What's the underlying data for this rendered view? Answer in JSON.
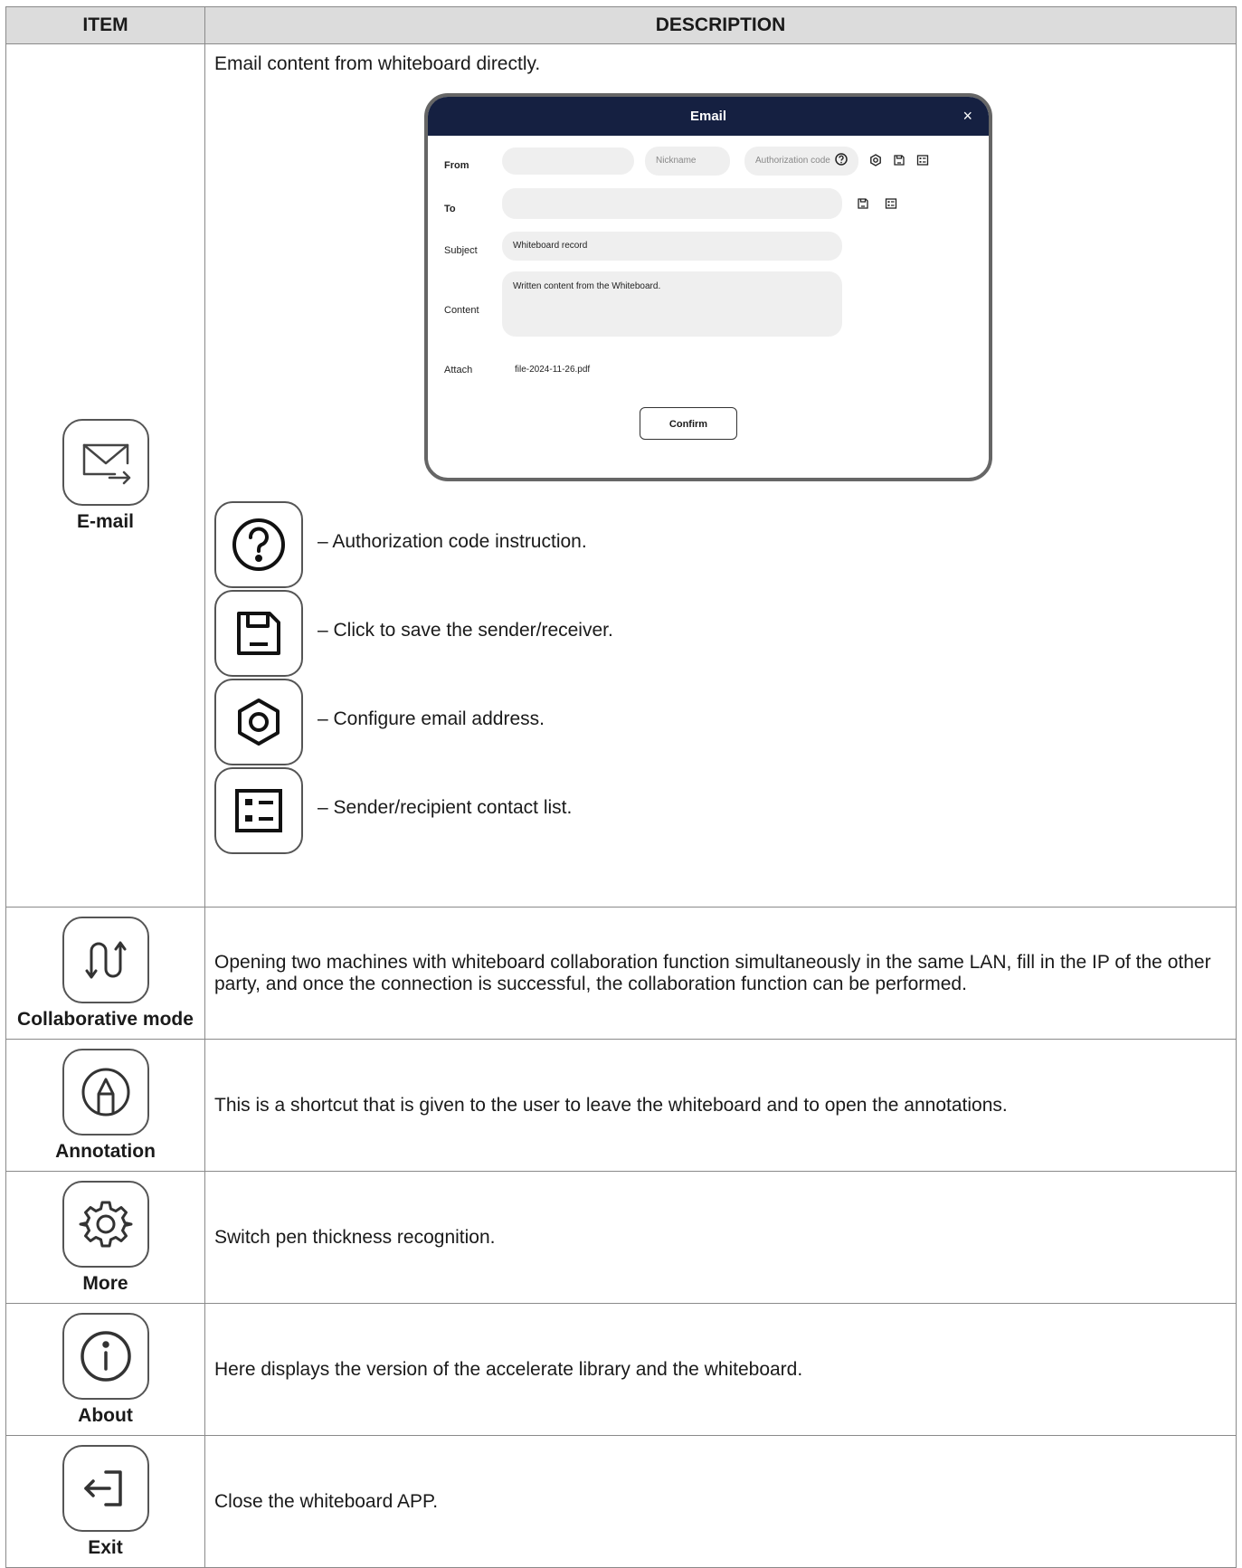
{
  "header": {
    "item": "ITEM",
    "description": "DESCRIPTION"
  },
  "email": {
    "label": "E-mail",
    "intro": "Email content from whiteboard directly.",
    "dialog": {
      "title": "Email",
      "close": "×",
      "from_label": "From",
      "nickname_placeholder": "Nickname",
      "auth_placeholder": "Authorization code",
      "to_label": "To",
      "subject_label": "Subject",
      "subject_value": "Whiteboard record",
      "content_label": "Content",
      "content_value": "Written content from the Whiteboard.",
      "attach_label": "Attach",
      "attach_value": "file-2024-11-26.pdf",
      "confirm": "Confirm"
    },
    "legend": [
      {
        "icon": "question-circle-icon",
        "text": "– Authorization code instruction."
      },
      {
        "icon": "save-icon",
        "text": "– Click to save the sender/receiver."
      },
      {
        "icon": "settings-hex-icon",
        "text": "– Configure email address."
      },
      {
        "icon": "contact-list-icon",
        "text": "– Sender/recipient contact list."
      }
    ]
  },
  "rows": [
    {
      "icon": "collaboration-arrows-icon",
      "label": "Collaborative mode",
      "description": "Opening two machines with whiteboard collaboration function simultaneously in the same LAN, fill in the IP of the other party, and once the connection is successful, the collaboration function can be performed."
    },
    {
      "icon": "annotation-pen-icon",
      "label": "Annotation",
      "description": "This is a shortcut that is given to the user to leave the whiteboard and to open the annotations."
    },
    {
      "icon": "gear-icon",
      "label": "More",
      "description": "Switch pen thickness recognition."
    },
    {
      "icon": "info-icon",
      "label": "About",
      "description": "Here displays the version of the accelerate library and the whiteboard."
    },
    {
      "icon": "exit-icon",
      "label": "Exit",
      "description": "Close the whiteboard APP."
    }
  ]
}
